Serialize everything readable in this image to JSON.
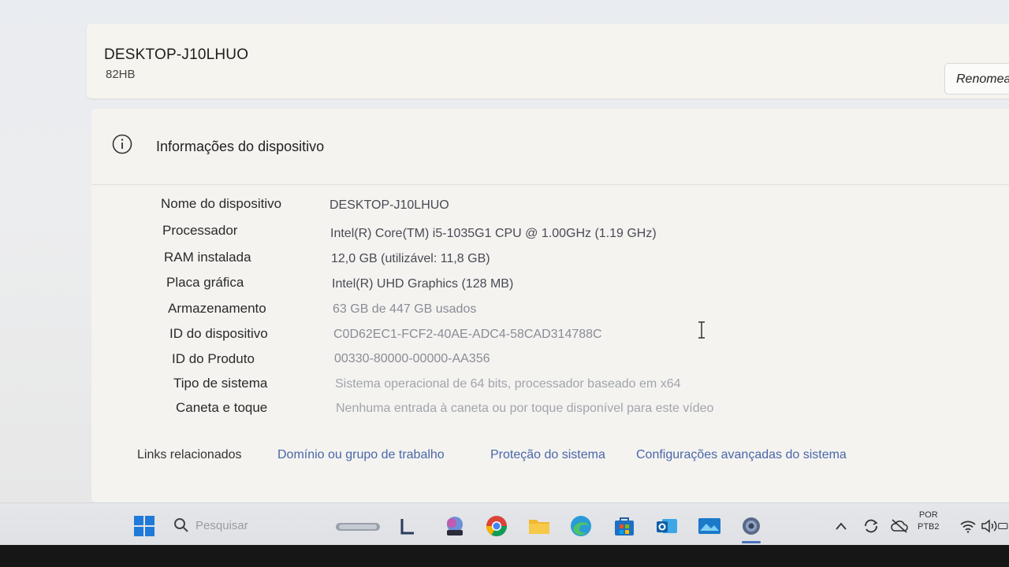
{
  "device": {
    "name": "DESKTOP-J10LHUO",
    "model": "82HB",
    "rename_label": "Renomear"
  },
  "info": {
    "title": "Informações do dispositivo",
    "icon": "info-icon",
    "specs": [
      {
        "label": "Nome do dispositivo",
        "value": "DESKTOP-J10LHUO"
      },
      {
        "label": "Processador",
        "value": "Intel(R) Core(TM) i5-1035G1 CPU @ 1.00GHz (1.19 GHz)"
      },
      {
        "label": "RAM instalada",
        "value": "12,0 GB (utilizável: 11,8 GB)"
      },
      {
        "label": "Placa gráfica",
        "value": "Intel(R) UHD Graphics (128 MB)"
      },
      {
        "label": "Armazenamento",
        "value": "63 GB de 447 GB usados"
      },
      {
        "label": "ID do dispositivo",
        "value": "C0D62EC1-FCF2-40AE-ADC4-58CAD314788C"
      },
      {
        "label": "ID do Produto",
        "value": "00330-80000-00000-AA356"
      },
      {
        "label": "Tipo de sistema",
        "value": "Sistema operacional de 64 bits, processador baseado em x64"
      },
      {
        "label": "Caneta e toque",
        "value": "Nenhuma entrada à caneta ou por toque disponível para este vídeo"
      }
    ]
  },
  "related_links": {
    "label": "Links relacionados",
    "links": [
      "Domínio ou grupo de trabalho",
      "Proteção do sistema",
      "Configurações avançadas do sistema"
    ]
  },
  "taskbar": {
    "search_placeholder": "Pesquisar",
    "language": "POR",
    "keyboard": "PTB2",
    "icons": [
      "windows-start-icon",
      "search-icon",
      "widgets-icon",
      "file-icon",
      "m365-icon",
      "chrome-icon",
      "file-explorer-icon",
      "edge-icon",
      "store-icon",
      "outlook-icon",
      "photos-icon",
      "settings-icon",
      "chevron-up-icon",
      "sync-icon",
      "cloud-off-icon",
      "wifi-icon",
      "volume-icon",
      "battery-icon"
    ]
  },
  "colors": {
    "link": "#4a67a8",
    "panel": "#f4f3f0",
    "taskbar": "#e1e3e7"
  }
}
